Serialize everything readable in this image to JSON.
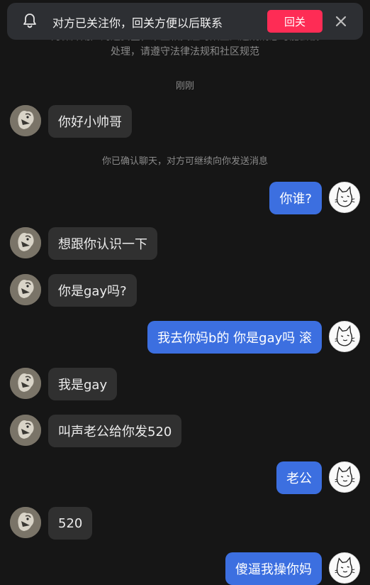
{
  "notice": {
    "text": "对方已关注你，回关方便以后联系",
    "follow_back_label": "回关",
    "bell_icon": "bell-icon",
    "close_icon": "close-icon"
  },
  "tips": {
    "line1": "为保障用户沟通安全，未互相关注时陌生人违规消息可能会被",
    "line2": "处理，请遵守法律法规和社区规范"
  },
  "timestamp": "刚刚",
  "system_message": "你已确认聊天，对方可继续向你发送消息",
  "colors": {
    "background": "#161616",
    "incoming_bubble": "#303030",
    "outgoing_bubble": "#3c6fe0",
    "follow_button": "#fe2c55"
  },
  "messages": [
    {
      "side": "left",
      "text": "你好小帅哥"
    },
    {
      "side": "right",
      "text": "你谁?"
    },
    {
      "side": "left",
      "text": "想跟你认识一下"
    },
    {
      "side": "left",
      "text": "你是gay吗?"
    },
    {
      "side": "right",
      "text": "我去你妈b的 你是gay吗 滚"
    },
    {
      "side": "left",
      "text": "我是gay"
    },
    {
      "side": "left",
      "text": "叫声老公给你发520"
    },
    {
      "side": "right",
      "text": "老公"
    },
    {
      "side": "left",
      "text": "520"
    },
    {
      "side": "right",
      "text": "傻逼我操你妈"
    }
  ]
}
